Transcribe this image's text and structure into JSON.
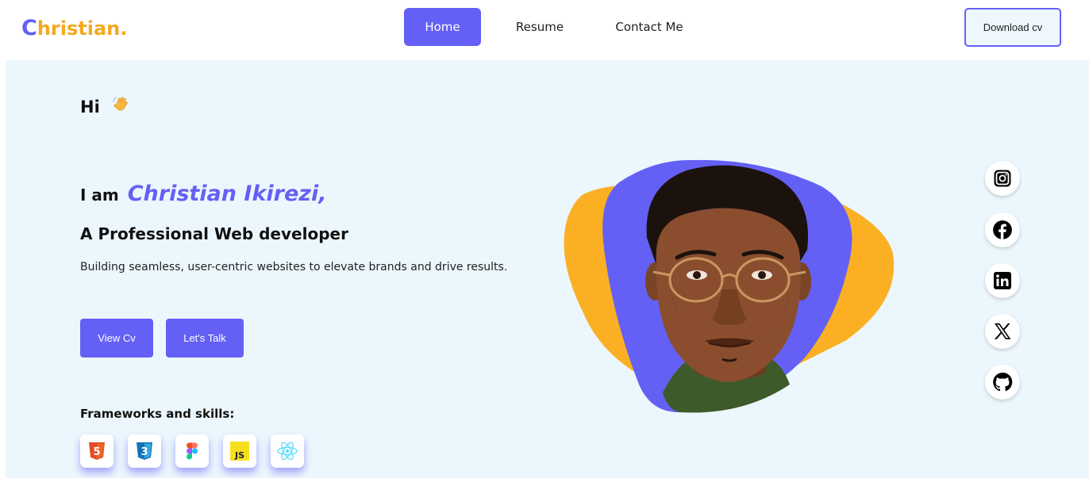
{
  "nav": {
    "logo_first": "C",
    "logo_rest": "hristian.",
    "links": [
      {
        "label": "Home",
        "active": true
      },
      {
        "label": "Resume",
        "active": false
      },
      {
        "label": "Contact Me",
        "active": false
      }
    ],
    "download_label": "Download cv"
  },
  "hero": {
    "greeting": "Hi",
    "iam": "I am",
    "name": "Christian Ikirezi,",
    "role": "A Professional Web developer",
    "description": "Building seamless, user-centric websites to elevate brands and drive results.",
    "view_cv_label": "View Cv",
    "lets_talk_label": "Let's Talk",
    "skills_title": "Frameworks and skills:",
    "skills": [
      {
        "icon": "html5-icon",
        "text": "5"
      },
      {
        "icon": "css3-icon",
        "text": "3"
      },
      {
        "icon": "figma-icon"
      },
      {
        "icon": "javascript-icon",
        "text": "JS"
      },
      {
        "icon": "react-icon"
      }
    ]
  },
  "social": [
    "instagram-icon",
    "facebook-icon",
    "linkedin-icon",
    "x-icon",
    "github-icon"
  ],
  "colors": {
    "accent": "#6460f5",
    "orange": "#f4a91f",
    "hero_bg": "#ecf7fd"
  }
}
